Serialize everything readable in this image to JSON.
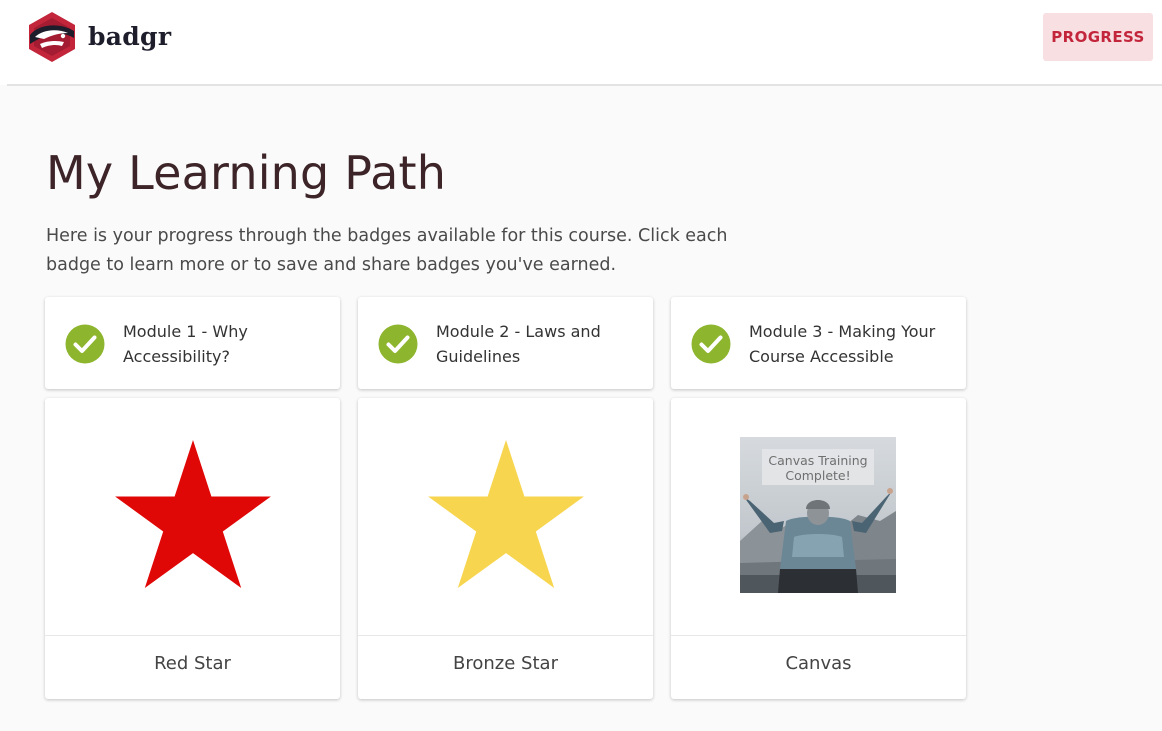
{
  "header": {
    "brand": "badgr",
    "progress_label": "PROGRESS"
  },
  "page": {
    "title": "My Learning Path",
    "intro": "Here is your progress through the badges available for this course. Click each badge to learn more or to save and share badges you've earned."
  },
  "modules": [
    {
      "name": "Module 1 - Why Accessibility?",
      "status": "complete",
      "icon": "check-circle-icon"
    },
    {
      "name": "Module 2 - Laws and Guidelines",
      "status": "complete",
      "icon": "check-circle-icon"
    },
    {
      "name": "Module 3 - Making Your Course Accessible",
      "status": "complete",
      "icon": "check-circle-icon"
    }
  ],
  "badges": [
    {
      "name": "Red Star",
      "image": "red-star-icon",
      "color": "#e00707"
    },
    {
      "name": "Bronze Star",
      "image": "yellow-star-icon",
      "color": "#f7d54f"
    },
    {
      "name": "Canvas",
      "image_caption": "Canvas Training Complete!"
    }
  ],
  "colors": {
    "accent": "#c3253b",
    "accent_bg": "#f7dfe2",
    "check": "#8db52d",
    "logo_red": "#c3253b",
    "logo_dark": "#1d1d2b"
  }
}
